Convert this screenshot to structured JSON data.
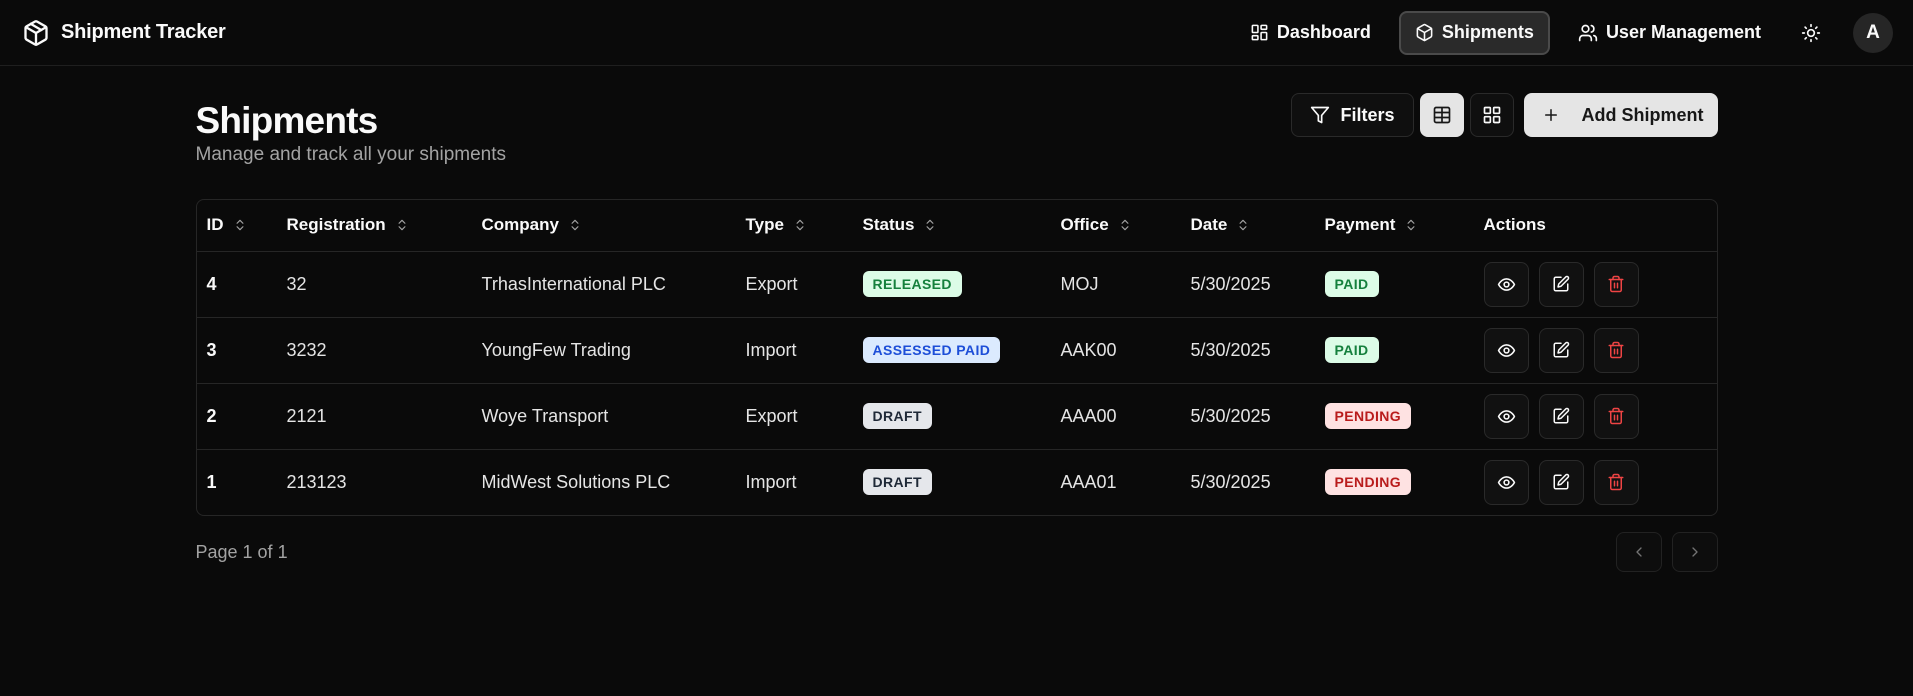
{
  "app": {
    "title": "Shipment Tracker",
    "logo_icon": "package-icon"
  },
  "nav": {
    "items": [
      {
        "label": "Dashboard",
        "icon": "dashboard-icon",
        "active": false
      },
      {
        "label": "Shipments",
        "icon": "package-icon",
        "active": true
      },
      {
        "label": "User Management",
        "icon": "users-icon",
        "active": false
      }
    ],
    "theme_icon": "sun-icon",
    "avatar_initial": "A"
  },
  "page": {
    "title": "Shipments",
    "subtitle": "Manage and track all your shipments"
  },
  "toolbar": {
    "filters_label": "Filters",
    "add_label": "Add Shipment",
    "view_mode": "table"
  },
  "table": {
    "columns": [
      "ID",
      "Registration",
      "Company",
      "Type",
      "Status",
      "Office",
      "Date",
      "Payment",
      "Actions"
    ],
    "rows": [
      {
        "id": "4",
        "registration": "32",
        "company": "TrhasInternational PLC",
        "type": "Export",
        "status": "RELEASED",
        "office": "MOJ",
        "date": "5/30/2025",
        "payment": "PAID"
      },
      {
        "id": "3",
        "registration": "3232",
        "company": "YoungFew Trading",
        "type": "Import",
        "status": "ASSESSED PAID",
        "office": "AAK00",
        "date": "5/30/2025",
        "payment": "PAID"
      },
      {
        "id": "2",
        "registration": "2121",
        "company": "Woye Transport",
        "type": "Export",
        "status": "DRAFT",
        "office": "AAA00",
        "date": "5/30/2025",
        "payment": "PENDING"
      },
      {
        "id": "1",
        "registration": "213123",
        "company": "MidWest Solutions PLC",
        "type": "Import",
        "status": "DRAFT",
        "office": "AAA01",
        "date": "5/30/2025",
        "payment": "PENDING"
      }
    ]
  },
  "pagination": {
    "label": "Page 1 of 1"
  },
  "colors": {
    "background": "#0a0a0a",
    "border": "#262626",
    "delete": "#ef4444",
    "primary_button": "#e5e5e5"
  }
}
